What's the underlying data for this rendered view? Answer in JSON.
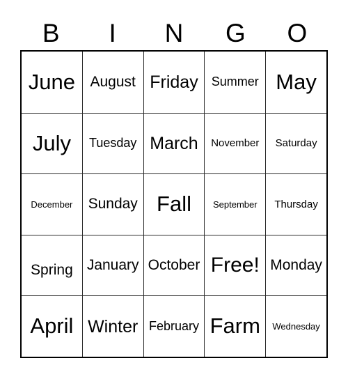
{
  "card": {
    "title": "BINGO Card",
    "header_letters": [
      "B",
      "I",
      "N",
      "G",
      "O"
    ],
    "free_space_label": "Free!",
    "colors": {
      "background": "#ffffff",
      "text": "#000000",
      "outer_border": "#000000",
      "inner_border": "#2b2b2b"
    },
    "rows": [
      [
        {
          "label": "June",
          "size": "t-xxl"
        },
        {
          "label": "August",
          "size": "t-md"
        },
        {
          "label": "Friday",
          "size": "t-lg"
        },
        {
          "label": "Summer",
          "size": "t-sm"
        },
        {
          "label": "May",
          "size": "t-xxl"
        }
      ],
      [
        {
          "label": "July",
          "size": "t-xxl"
        },
        {
          "label": "Tuesday",
          "size": "t-sm"
        },
        {
          "label": "March",
          "size": "t-lg"
        },
        {
          "label": "November",
          "size": "t-xs"
        },
        {
          "label": "Saturday",
          "size": "t-xs"
        }
      ],
      [
        {
          "label": "December",
          "size": "t-xxs"
        },
        {
          "label": "Sunday",
          "size": "t-md"
        },
        {
          "label": "Fall",
          "size": "t-xxl"
        },
        {
          "label": "September",
          "size": "t-xxs"
        },
        {
          "label": "Thursday",
          "size": "t-xs"
        }
      ],
      [
        {
          "label": "Spring",
          "size": "t-md"
        },
        {
          "label": "January",
          "size": "t-md"
        },
        {
          "label": "October",
          "size": "t-md"
        },
        {
          "label": "Free!",
          "size": "t-xl"
        },
        {
          "label": "Monday",
          "size": "t-md"
        }
      ],
      [
        {
          "label": "April",
          "size": "t-xxl"
        },
        {
          "label": "Winter",
          "size": "t-lg"
        },
        {
          "label": "February",
          "size": "t-sm"
        },
        {
          "label": "Farm",
          "size": "t-xxl"
        },
        {
          "label": "Wednesday",
          "size": "t-xxs"
        }
      ]
    ]
  }
}
